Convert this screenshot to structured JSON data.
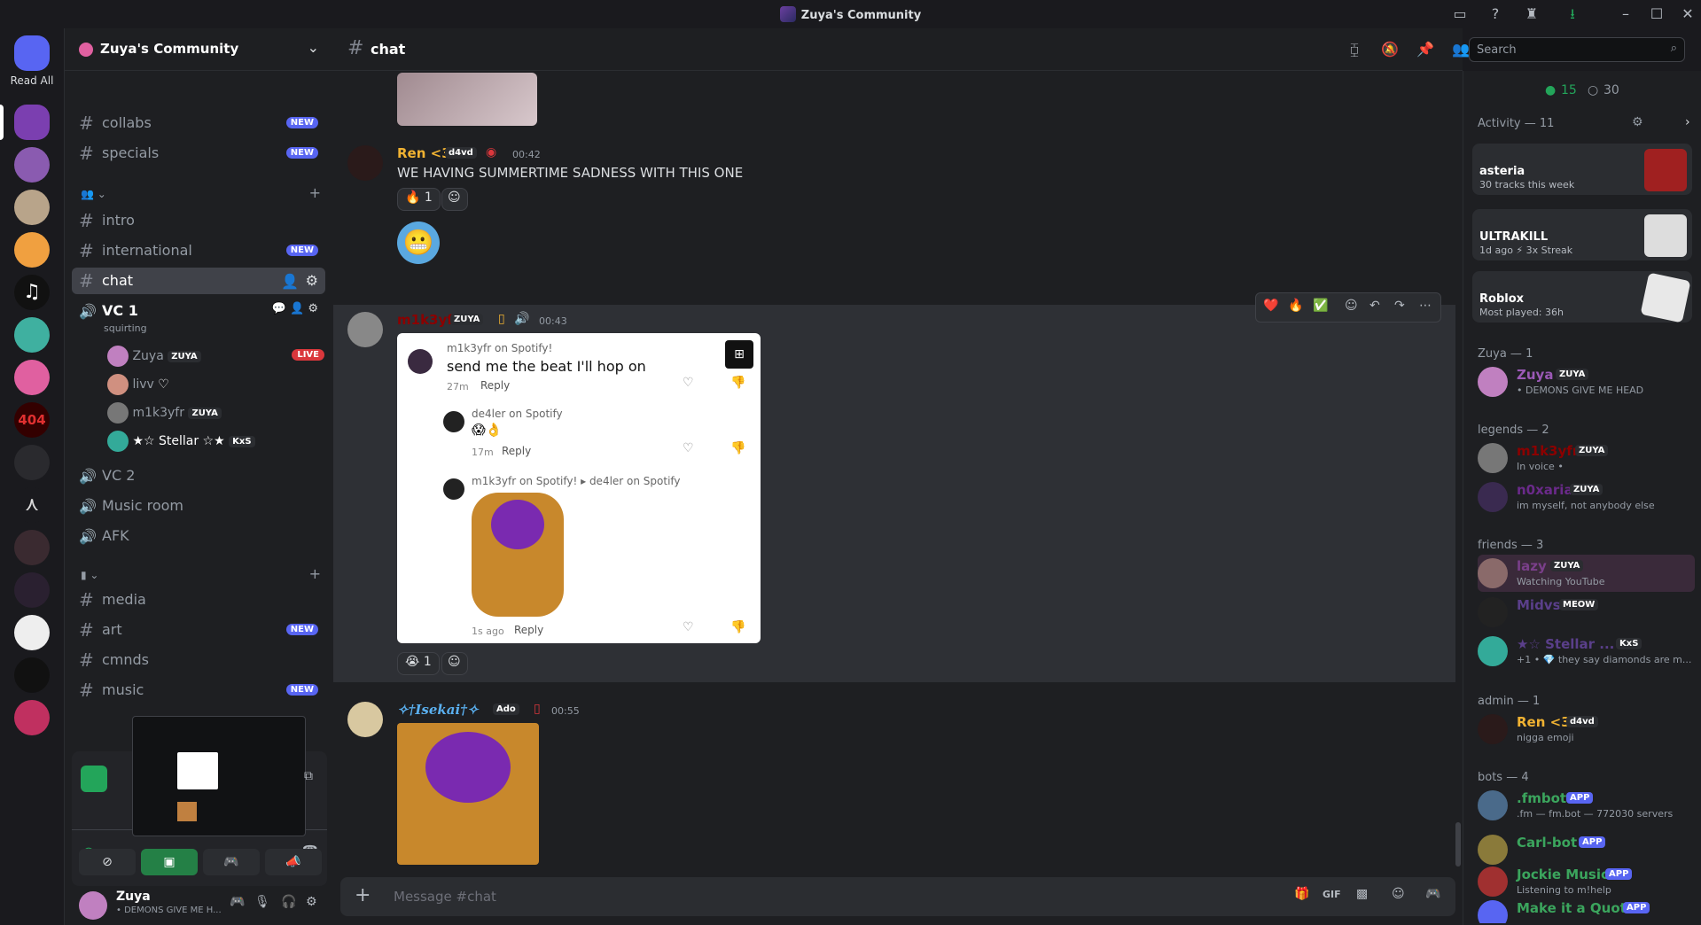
{
  "window": {
    "title": "Zuya's Community"
  },
  "rail": {
    "read_all": "Read All"
  },
  "server": {
    "name": "Zuya's Community"
  },
  "channels": {
    "top": [
      {
        "name": "collabs",
        "badge": "NEW"
      },
      {
        "name": "specials",
        "badge": "NEW"
      }
    ],
    "cat2": [
      {
        "name": "intro",
        "badge": ""
      },
      {
        "name": "international",
        "badge": "NEW"
      },
      {
        "name": "chat",
        "badge": ""
      }
    ],
    "voice": [
      {
        "name": "VC 1",
        "status": "squirting"
      },
      {
        "name": "VC 2"
      },
      {
        "name": "Music room"
      },
      {
        "name": "AFK"
      }
    ],
    "vc1_users": [
      {
        "name": "Zuya",
        "tag": "ZUYA",
        "badge": "LIVE"
      },
      {
        "name": "livv",
        "tag": ""
      },
      {
        "name": "m1k3yfr",
        "tag": "ZUYA"
      },
      {
        "name": "★☆ Stellar ☆★",
        "tag": "KxS"
      }
    ],
    "cat3": [
      {
        "name": "media",
        "badge": ""
      },
      {
        "name": "art",
        "badge": "NEW"
      },
      {
        "name": "cmnds",
        "badge": ""
      },
      {
        "name": "music",
        "badge": "NEW"
      }
    ]
  },
  "user": {
    "name": "Zuya",
    "status": "• DEMONS GIVE ME H..."
  },
  "header": {
    "channel": "chat",
    "search_placeholder": "Search"
  },
  "messages": [
    {
      "author": "Ren <3",
      "tag": "d4vd",
      "time": "00:42",
      "text": "WE HAVING SUMMERTIME SADNESS WITH THIS ONE",
      "reaction": "🔥",
      "count": "1"
    },
    {
      "author": "m1k3yfr",
      "tag": "ZUYA",
      "time": "00:43",
      "reaction": "😭",
      "count": "1"
    },
    {
      "author": "✧†Isekai†✧",
      "tag": "Ado",
      "time": "00:55"
    }
  ],
  "embed": {
    "c1_author": "m1k3yfr on Spotify!",
    "c1_text": "send me the beat I'll hop on",
    "c1_time": "27m",
    "c2_author": "de4ler on Spotify",
    "c2_text": "😱👌",
    "c2_time": "17m",
    "c3_author": "m1k3yfr on Spotify! ▸ de4ler on Spotify",
    "c3_time": "1s ago",
    "reply": "Reply"
  },
  "composer": {
    "placeholder": "Message #chat"
  },
  "members": {
    "online": "15",
    "total": "30",
    "activity_header": "Activity — 11",
    "activities": [
      {
        "title": "asteria",
        "sub": "30 tracks this week"
      },
      {
        "title": "ULTRAKILL",
        "sub": "1d ago  ⚡ 3x Streak"
      },
      {
        "title": "Roblox",
        "sub": "Most played: 36h"
      }
    ],
    "groups": [
      {
        "label": "Zuya — 1",
        "items": [
          {
            "name": "Zuya",
            "tag": "ZUYA",
            "status": "• DEMONS GIVE ME HEAD",
            "color": "#9b59b6"
          }
        ]
      },
      {
        "label": "legends — 2",
        "items": [
          {
            "name": "m1k3yfr",
            "tag": "ZUYA",
            "status": "In voice •",
            "color": "#8b0000"
          },
          {
            "name": "n0xaria",
            "tag": "ZUYA",
            "status": "im myself, not anybody else",
            "color": "#6a2a8a"
          }
        ]
      },
      {
        "label": "friends — 3",
        "items": [
          {
            "name": "lazy",
            "tag": "ZUYA",
            "status": "Watching YouTube",
            "color": "#7a3f8a"
          },
          {
            "name": "Midvs",
            "tag": "MEOW",
            "status": "",
            "color": "#5a3f8a"
          },
          {
            "name": "★☆ Stellar ...",
            "tag": "KxS",
            "status": "+1 • 💎 they say diamonds are m...",
            "color": "#5a3f8a"
          }
        ]
      },
      {
        "label": "admin — 1",
        "items": [
          {
            "name": "Ren <3",
            "tag": "d4vd",
            "status": "nigga emoji",
            "color": "#f0b232"
          }
        ]
      },
      {
        "label": "bots — 4",
        "items": [
          {
            "name": ".fmbot",
            "tag": "APP",
            "status": ".fm — fm.bot — 772030 servers",
            "color": "#3ba55d"
          },
          {
            "name": "Carl-bot",
            "tag": "APP",
            "status": "",
            "color": "#3ba55d"
          },
          {
            "name": "Jockie Music",
            "tag": "APP",
            "status": "Listening to m!help",
            "color": "#3ba55d"
          },
          {
            "name": "Make it a Quote",
            "tag": "APP",
            "status": "",
            "color": "#3ba55d"
          }
        ]
      }
    ]
  },
  "colors": {
    "accent": "#5865f2",
    "live": "#da373c",
    "online": "#23a55a"
  }
}
